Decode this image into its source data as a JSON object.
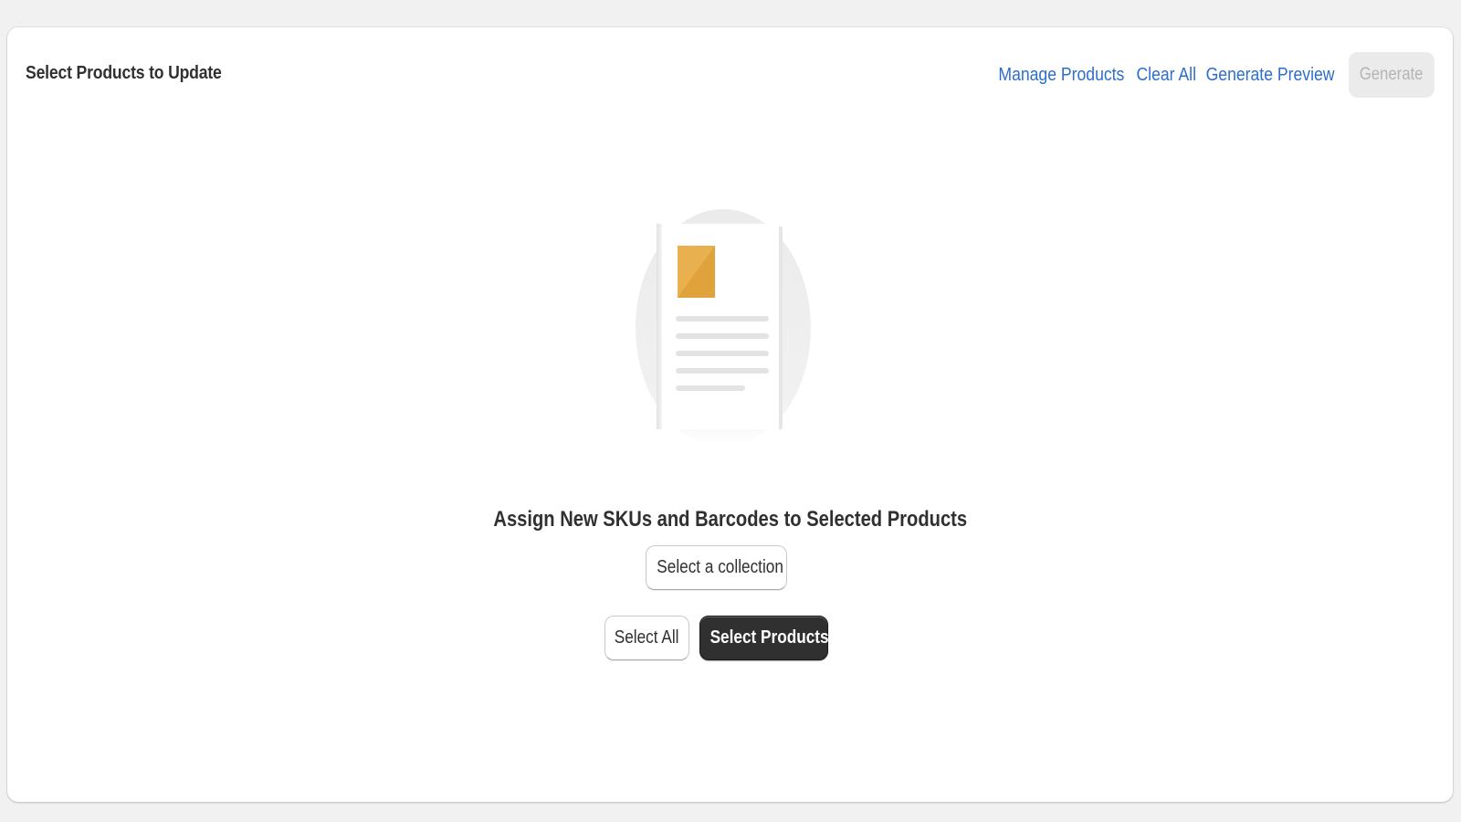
{
  "header": {
    "title": "Select Products to Update",
    "actions": {
      "manage_products": "Manage Products",
      "clear_all": "Clear All",
      "generate_preview": "Generate Preview",
      "generate": "Generate"
    }
  },
  "empty_state": {
    "heading": "Assign New SKUs and Barcodes to Selected Products",
    "select_collection": "Select a collection",
    "select_all": "Select All",
    "select_products": "Select Products",
    "illustration_icon": "document-icon"
  },
  "colors": {
    "link": "#2c6ecb",
    "primary_button": "#303030",
    "disabled_button": "#ebebeb",
    "illustration_accent": "#e0a23a"
  }
}
